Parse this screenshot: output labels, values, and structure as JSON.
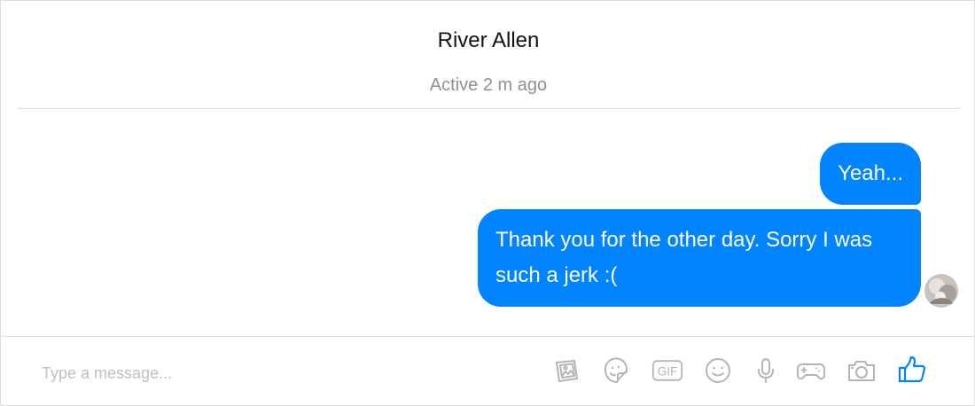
{
  "header": {
    "contact_name": "River Allen",
    "status": "Active 2 m ago"
  },
  "messages": [
    {
      "text": "Yeah...",
      "direction": "outgoing"
    },
    {
      "text": "Thank you for the other day. Sorry I was such a jerk :(",
      "direction": "outgoing"
    }
  ],
  "composer": {
    "placeholder": "Type a message...",
    "gif_label": "GIF",
    "tools": [
      "photo-icon",
      "sticker-icon",
      "gif-icon",
      "emoji-icon",
      "microphone-icon",
      "game-controller-icon",
      "camera-icon",
      "thumbs-up-icon"
    ]
  },
  "colors": {
    "bubble": "#0084ff",
    "bubble_text": "#ffffff",
    "icon_gray": "#b5b5b5",
    "like_blue": "#0084ff",
    "divider": "#dddddd"
  }
}
